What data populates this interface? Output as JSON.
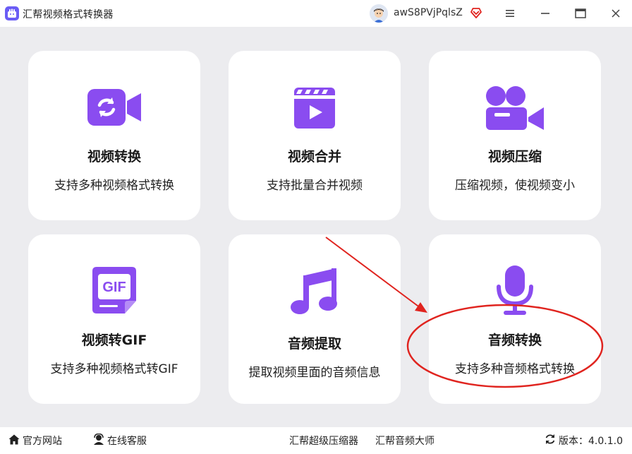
{
  "window": {
    "title": "汇帮视频格式转换器",
    "username": "awS8PVjPqlsZ",
    "icons": [
      "app-logo-icon",
      "avatar",
      "vip-heart-icon",
      "menu-icon",
      "minimize-icon",
      "maximize-icon",
      "close-icon"
    ]
  },
  "cards": [
    {
      "title": "视频转换",
      "desc": "支持多种视频格式转换",
      "icon": "video-convert-icon"
    },
    {
      "title": "视频合并",
      "desc": "支持批量合并视频",
      "icon": "video-merge-icon"
    },
    {
      "title": "视频压缩",
      "desc": "压缩视频，使视频变小",
      "icon": "video-compress-icon"
    },
    {
      "title": "视频转GIF",
      "desc": "支持多种视频格式转GIF",
      "icon": "gif-icon"
    },
    {
      "title": "音频提取",
      "desc": "提取视频里面的音频信息",
      "icon": "music-note-icon"
    },
    {
      "title": "音频转换",
      "desc": "支持多种音频格式转换",
      "icon": "microphone-icon"
    }
  ],
  "footer": {
    "website": "官方网站",
    "support": "在线客服",
    "link1": "汇帮超级压缩器",
    "link2": "汇帮音频大师",
    "version": "版本：4.0.1.0"
  },
  "colors": {
    "accent": "#8a4cf0",
    "annotation": "#e0241f",
    "background": "#ececef"
  }
}
